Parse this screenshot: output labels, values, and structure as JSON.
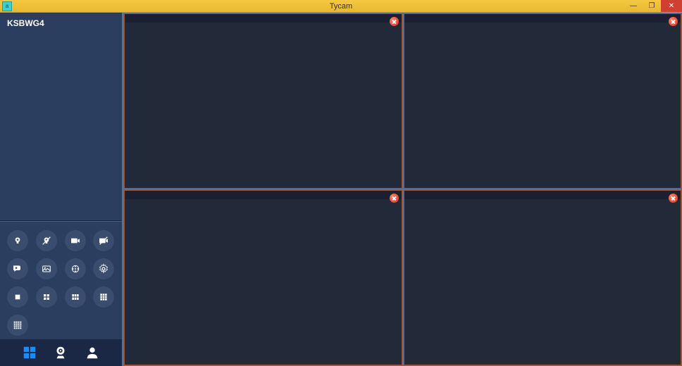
{
  "titlebar": {
    "title": "Tycam",
    "icon_label": "a",
    "minimize": "—",
    "maximize": "❐",
    "close": "✕"
  },
  "sidebar": {
    "device_label": "KSBWG4"
  },
  "colors": {
    "titlebar_bg": "#f5c842",
    "sidebar_bg": "#2c3e5f",
    "pane_bg": "#222a3a",
    "accent": "#1a8cff"
  }
}
